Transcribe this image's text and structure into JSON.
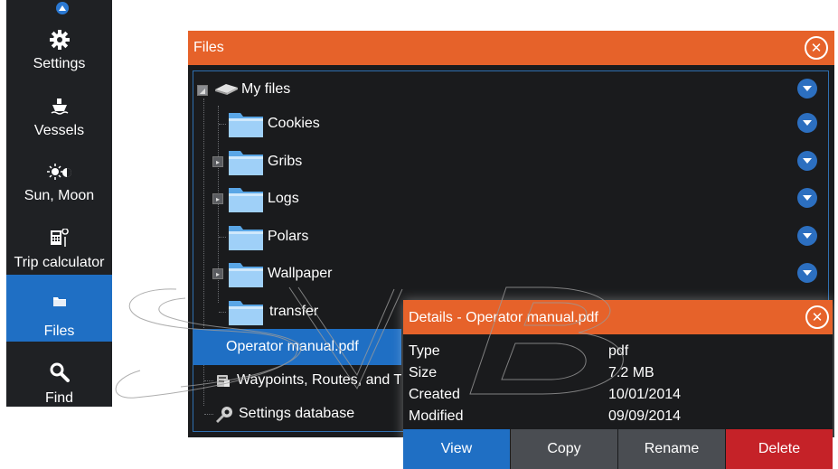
{
  "sidebar": {
    "items": [
      {
        "label": "Settings",
        "icon": "gear-icon"
      },
      {
        "label": "Vessels",
        "icon": "vessel-icon"
      },
      {
        "label": "Sun, Moon",
        "icon": "sun-moon-icon"
      },
      {
        "label": "Trip calculator",
        "icon": "calculator-icon"
      },
      {
        "label": "Files",
        "icon": "folder-icon",
        "active": true
      },
      {
        "label": "Find",
        "icon": "magnifier-icon"
      }
    ]
  },
  "files_window": {
    "title": "Files",
    "tree": {
      "root": "My files",
      "folders": [
        "Cookies",
        "Gribs",
        "Logs",
        "Polars",
        "Wallpaper",
        "transfer"
      ],
      "selected_file": "Operator manual.pdf",
      "databases": [
        "Waypoints, Routes, and Tracks database",
        "Settings database"
      ]
    }
  },
  "details_dialog": {
    "title": "Details - Operator manual.pdf",
    "fields": [
      {
        "key": "Type",
        "value": "pdf"
      },
      {
        "key": "Size",
        "value": "7.2 MB"
      },
      {
        "key": "Created",
        "value": "10/01/2014"
      },
      {
        "key": "Modified",
        "value": "09/09/2014"
      }
    ],
    "buttons": [
      "View",
      "Copy",
      "Rename",
      "Delete"
    ]
  },
  "colors": {
    "title_bar": "#e6622a",
    "accent_blue": "#1f6fc4",
    "delete_red": "#c52228",
    "background_dark": "#1a1b1d"
  }
}
